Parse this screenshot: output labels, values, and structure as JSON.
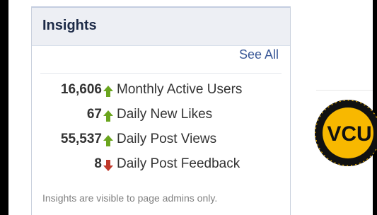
{
  "insights": {
    "title": "Insights",
    "see_all": "See All",
    "stats": [
      {
        "value": "16,606",
        "label": "Monthly Active Users",
        "trend": "up"
      },
      {
        "value": "67",
        "label": "Daily New Likes",
        "trend": "up"
      },
      {
        "value": "55,537",
        "label": "Daily Post Views",
        "trend": "up"
      },
      {
        "value": "8",
        "label": "Daily Post Feedback",
        "trend": "down"
      }
    ],
    "footnote": "Insights are visible to page admins only."
  },
  "logo": {
    "text": "VCU",
    "icon": "vcu-seal-logo"
  },
  "colors": {
    "header_bg": "#edeff4",
    "link": "#3b5998",
    "up_arrow": "#6aa51e",
    "down_arrow": "#c0392b",
    "logo_gold": "#f8b800"
  }
}
